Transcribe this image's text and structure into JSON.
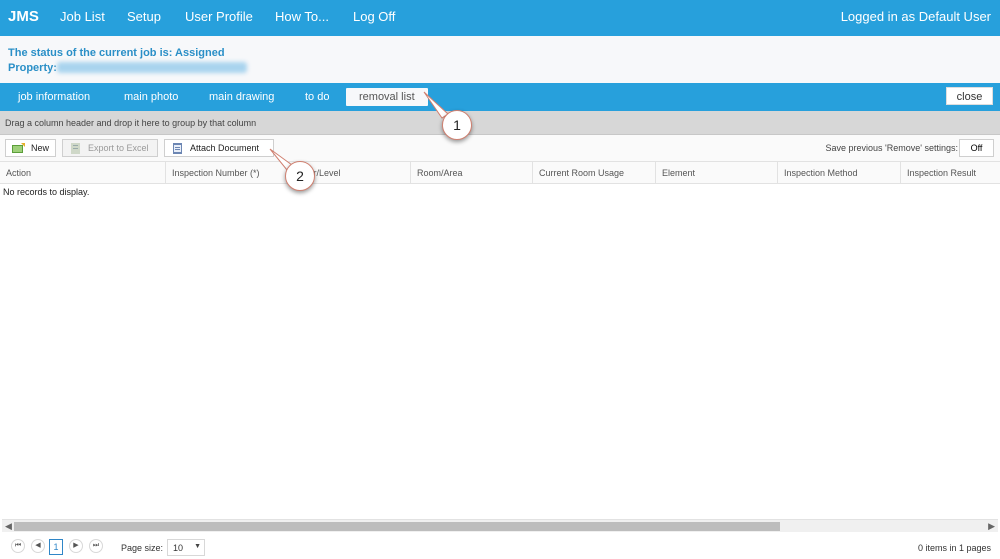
{
  "app": {
    "brand": "JMS",
    "logged_in": "Logged in as Default User"
  },
  "nav": [
    "Job List",
    "Setup",
    "User Profile",
    "How To...",
    "Log Off"
  ],
  "status": {
    "line1": "The status of the current job is: Assigned",
    "property_label": "Property:"
  },
  "tabs": [
    "job information",
    "main photo",
    "main drawing",
    "to do",
    "removal list"
  ],
  "active_tab": "removal list",
  "close_label": "close",
  "group_hint": "Drag a column header and drop it here to group by that column",
  "toolbar": {
    "new_label": "New",
    "export_label": "Export to Excel",
    "attach_label": "Attach Document",
    "save_setting_label": "Save previous 'Remove' settings:",
    "save_setting_value": "Off"
  },
  "columns": [
    "Action",
    "Inspection Number (*)",
    "Floor/Level",
    "Room/Area",
    "Current Room Usage",
    "Element",
    "Inspection Method",
    "Inspection Result"
  ],
  "empty_text": "No records to display.",
  "pager": {
    "current_page": "1",
    "page_size_label": "Page size:",
    "page_size_value": "10",
    "items_info": "0 items in 1 pages"
  },
  "callouts": [
    "1",
    "2"
  ],
  "colors": {
    "accent": "#27a0dc",
    "status_text": "#2a8fc7"
  }
}
